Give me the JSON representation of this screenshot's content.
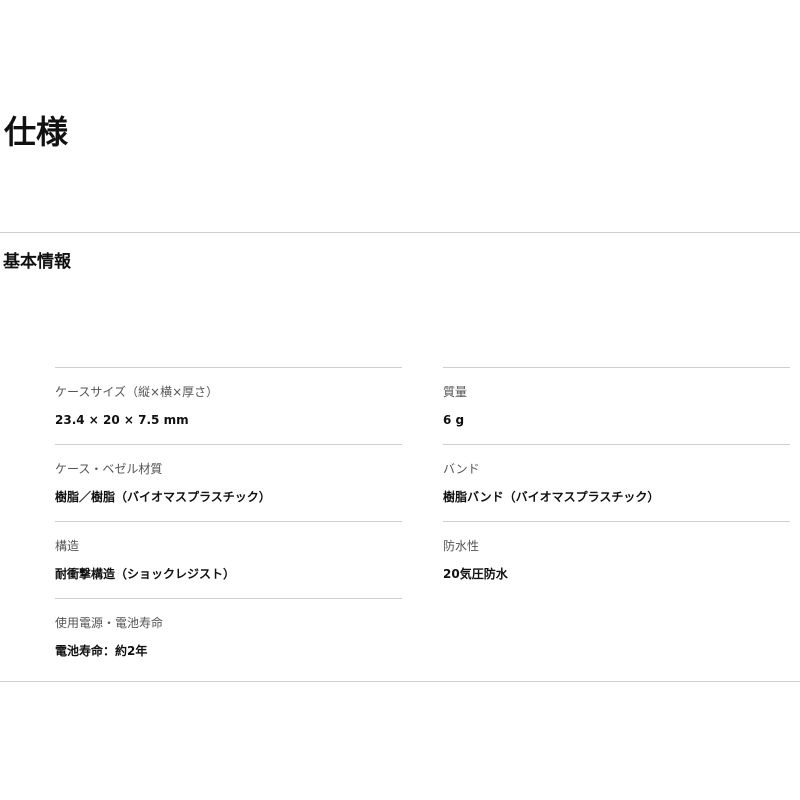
{
  "page": {
    "title": "仕様"
  },
  "section": {
    "title": "基本情報"
  },
  "specs": {
    "left": [
      {
        "label": "ケースサイズ（縦×横×厚さ）",
        "value": "23.4 × 20 × 7.5 mm"
      },
      {
        "label": "ケース・ベゼル材質",
        "value": "樹脂／樹脂（バイオマスプラスチック）"
      },
      {
        "label": "構造",
        "value": "耐衝撃構造（ショックレジスト）"
      },
      {
        "label": "使用電源・電池寿命",
        "value": "電池寿命：約2年"
      }
    ],
    "right": [
      {
        "label": "質量",
        "value": "6 g"
      },
      {
        "label": "バンド",
        "value": "樹脂バンド（バイオマスプラスチック）"
      },
      {
        "label": "防水性",
        "value": "20気圧防水"
      }
    ]
  }
}
